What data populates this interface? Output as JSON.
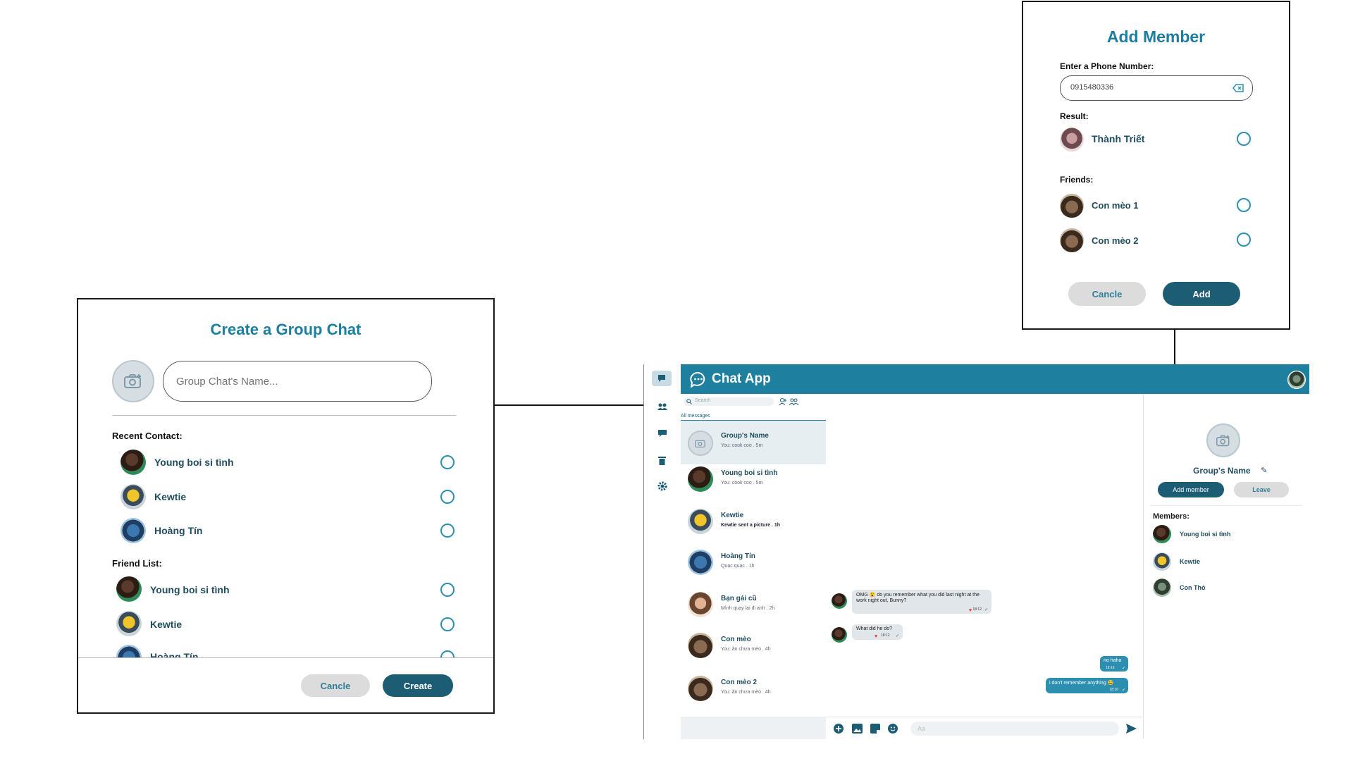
{
  "create_group": {
    "title": "Create a Group Chat",
    "name_placeholder": "Group Chat's Name...",
    "recent_label": "Recent Contact:",
    "recent": [
      "Young boi si tình",
      "Kewtie",
      "Hoàng Tín"
    ],
    "friends_label": "Friend List:",
    "friends": [
      "Young boi si tình",
      "Kewtie",
      "Hoàng Tín"
    ],
    "cancel": "Cancle",
    "create": "Create"
  },
  "add_member": {
    "title": "Add Member",
    "phone_label": "Enter a Phone Number:",
    "phone_value": "0915480336",
    "result_label": "Result:",
    "result_name": "Thành Triết",
    "friends_label": "Friends:",
    "friends": [
      "Con mèo 1",
      "Con mèo 2"
    ],
    "cancel": "Cancle",
    "add": "Add"
  },
  "app": {
    "title": "Chat App",
    "search_placeholder": "Search",
    "tab_all": "All messages",
    "conversations": [
      {
        "name": "Group's Name",
        "preview": "You: cook coo . 5m"
      },
      {
        "name": "Young boi si tình",
        "preview": "You: cook coo . 5m"
      },
      {
        "name": "Kewtie",
        "preview": "Kewtie sent a picture . 1h"
      },
      {
        "name": "Hoàng Tín",
        "preview": "Quạc quạc . 1h"
      },
      {
        "name": "Bạn gái cũ",
        "preview": "Mình quay lại đi anh . 2h"
      },
      {
        "name": "Con mèo",
        "preview": "You: ăn chưa mèo . 4h"
      },
      {
        "name": "Con mèo 2",
        "preview": "You: ăn chưa mèo . 4h"
      }
    ],
    "messages": [
      {
        "text": "OMG 😮 do you remember what you did last night at the work night out, Bunny?",
        "time": "18:12"
      },
      {
        "text": "What did he do?",
        "time": "18:12"
      },
      {
        "text": "no haha",
        "time": "18:16"
      },
      {
        "text": "i don't remember anything 😅",
        "time": "18:16"
      }
    ],
    "composer_placeholder": "Aa",
    "group_name": "Group's Name",
    "add_member_btn": "Add member",
    "leave_btn": "Leave",
    "members_label": "Members:",
    "members": [
      "Young boi si tình",
      "Kewtie",
      "Con Thỏ"
    ]
  },
  "colors": {
    "accent": "#1c7fa1",
    "header": "#1e7f9f",
    "dark_button": "#1d5d74"
  }
}
